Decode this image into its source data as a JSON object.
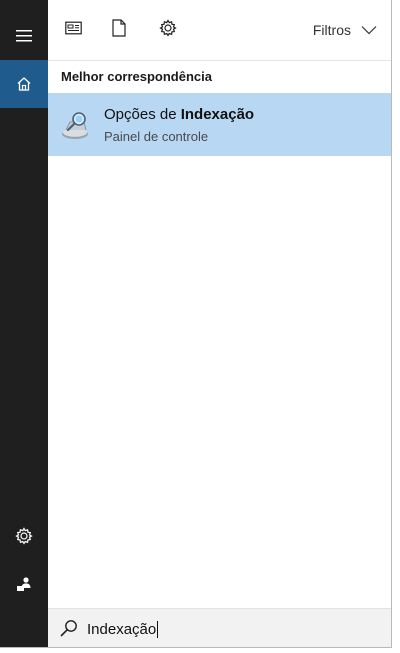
{
  "toolbar": {
    "icons": [
      "newspaper-icon",
      "document-icon",
      "gear-icon"
    ],
    "filters_label": "Filtros"
  },
  "section": {
    "title": "Melhor correspondência"
  },
  "best_match": {
    "title_prefix": "Opções de ",
    "title_bold": "Indexação",
    "subtitle": "Painel de controle",
    "icon": "indexing-options-icon"
  },
  "search": {
    "value": "Indexação",
    "icon": "search-icon"
  },
  "rail": {
    "items": [
      "hamburger-menu-icon",
      "home-icon",
      "settings-icon",
      "user-icon"
    ]
  },
  "colors": {
    "rail_background": "#1f1f1f",
    "rail_active": "#1f5b8c",
    "result_highlight": "#b8d7f2",
    "search_background": "#f2f2f2"
  }
}
